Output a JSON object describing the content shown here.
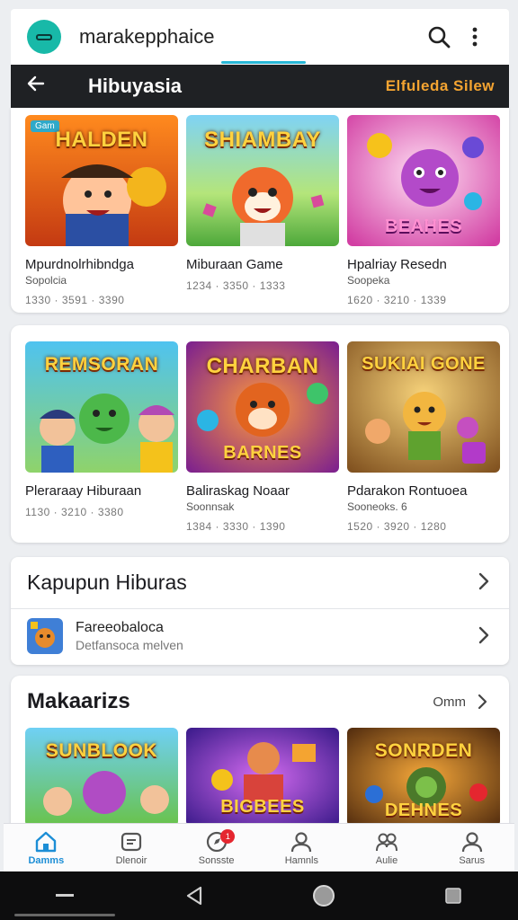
{
  "app_bar": {
    "title": "marakepphaice",
    "search_icon": "search-icon",
    "more_icon": "more-vert-icon"
  },
  "sub_bar": {
    "title": "Hibuyasia",
    "action": "Elfuleda Silew",
    "back_icon": "arrow-left-icon"
  },
  "grid1": [
    {
      "art": "HALDEN",
      "badge": "Gam",
      "title": "Mpurdnolrhibndga",
      "sub": "Sopolcia",
      "meta": "1330 · 3591 · 3390"
    },
    {
      "art": "SHIAMBAY",
      "title": "Miburaan Game",
      "sub": "",
      "meta": "1234 · 3350 · 1333"
    },
    {
      "art": "BEAHES",
      "title": "Hpalriay Resedn",
      "sub": "Soopeka",
      "meta": "1620 · 3210 · 1339"
    }
  ],
  "grid2": [
    {
      "art": "REMSORAN",
      "title": "Pleraraay Hiburaan",
      "sub": "",
      "meta": "1130 · 3210 · 3380"
    },
    {
      "art": "CHARBAN",
      "art2": "BARNES",
      "title": "Baliraskag Noaar",
      "sub": "Soonnsak",
      "meta": "1384 · 3330 · 1390"
    },
    {
      "art": "SUKIAI GONE",
      "title": "Pdarakon Rontuoea",
      "sub": "Sooneoks. 6",
      "meta": "1520 · 3920 · 1280"
    }
  ],
  "list": {
    "header": "Kapupun Hiburas",
    "item_title": "Fareeobaloca",
    "item_sub": "Detfansoca melven"
  },
  "section": {
    "title": "Makaarizs",
    "more": "Omm",
    "tiles": [
      {
        "art": "SUNBLOOK"
      },
      {
        "art": "BIGBEES"
      },
      {
        "art": "SONRDEN",
        "art2": "DEHNES"
      }
    ]
  },
  "bottom_nav": [
    {
      "label": "Damms",
      "icon": "home-icon",
      "active": true
    },
    {
      "label": "Dlenoir",
      "icon": "wallet-icon"
    },
    {
      "label": "Sonsste",
      "icon": "compass-icon",
      "badge": "1"
    },
    {
      "label": "Hamnls",
      "icon": "person-icon"
    },
    {
      "label": "Aulie",
      "icon": "people-icon"
    },
    {
      "label": "Sarus",
      "icon": "profile-icon"
    }
  ],
  "colors": {
    "accent": "#1c8ed6",
    "logo": "#18b9a8",
    "header_dark": "#1f2124",
    "action_orange": "#f4a431",
    "badge_red": "#e5262f"
  }
}
